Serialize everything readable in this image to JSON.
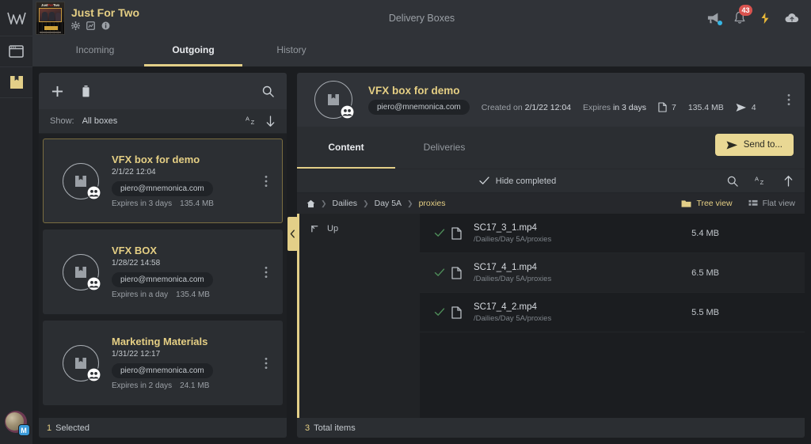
{
  "rail": {
    "logo_icon": "mnemonica-logo-icon",
    "items": [
      {
        "icon": "panel-window-icon",
        "name": "workspace",
        "active": false
      },
      {
        "icon": "delivery-box-icon",
        "name": "delivery-boxes",
        "active": true
      }
    ],
    "avatar_badge": "M"
  },
  "topbar": {
    "poster_title_a": "Just",
    "poster_title_b": "For",
    "poster_title_c": "Two",
    "show_title": "Just For Two",
    "show_icons": [
      "gear-icon",
      "reports-icon",
      "info-icon"
    ],
    "app_title": "Delivery Boxes",
    "right_icons": [
      "megaphone-icon",
      "bell-icon",
      "activity-icon",
      "upload-cloud-icon"
    ],
    "notification_count": "43"
  },
  "tabs": [
    {
      "label": "Incoming",
      "active": false
    },
    {
      "label": "Outgoing",
      "active": true
    },
    {
      "label": "History",
      "active": false
    }
  ],
  "boxes_panel": {
    "toolbar_icons": [
      "add-icon",
      "delete-icon",
      "search-icon"
    ],
    "filter": {
      "show_label": "Show:",
      "show_value": "All boxes",
      "sort_icon": "sort-az-icon",
      "direction_icon": "arrow-down-icon"
    },
    "cards": [
      {
        "name": "VFX box for demo",
        "date": "2/1/22 12:04",
        "email": "piero@mnemonica.com",
        "expires": "Expires in 3 days",
        "size": "135.4 MB",
        "selected": true
      },
      {
        "name": "VFX BOX",
        "date": "1/28/22 14:58",
        "email": "piero@mnemonica.com",
        "expires": "Expires in a day",
        "size": "135.4 MB",
        "selected": false
      },
      {
        "name": "Marketing Materials",
        "date": "1/31/22 12:17",
        "email": "piero@mnemonica.com",
        "expires": "Expires in 2 days",
        "size": "24.1 MB",
        "selected": false
      }
    ],
    "footer_count": "1",
    "footer_label": "Selected"
  },
  "collapse_handle": {
    "icon": "chevron-left-icon"
  },
  "detail": {
    "header": {
      "title": "VFX box for demo",
      "email": "piero@mnemonica.com",
      "created_label": "Created on",
      "created_value": "2/1/22 12:04",
      "expires_label": "Expires",
      "expires_value": "in 3 days",
      "file_count": "7",
      "size": "135.4 MB",
      "deliveries_count": "4",
      "menu_icon": "kebab-menu-icon"
    },
    "tabs": [
      {
        "label": "Content",
        "active": true
      },
      {
        "label": "Deliveries",
        "active": false
      }
    ],
    "send_button": "Send to...",
    "subtools": {
      "hide_completed": "Hide completed",
      "icons": [
        "search-icon",
        "sort-az-icon",
        "arrow-up-icon"
      ]
    },
    "breadcrumb": {
      "home_icon": "home-icon",
      "crumbs": [
        {
          "label": "Dailies",
          "active": false
        },
        {
          "label": "Day 5A",
          "active": false
        },
        {
          "label": "proxies",
          "active": true
        }
      ]
    },
    "views": [
      {
        "label": "Tree view",
        "icon": "folder-icon",
        "active": true
      },
      {
        "label": "Flat view",
        "icon": "list-icon",
        "active": false
      }
    ],
    "tree": [
      {
        "label": "Up",
        "icon": "arrow-up-left-icon"
      }
    ],
    "files": [
      {
        "name": "SC17_3_1.mp4",
        "path": "/Dailies/Day 5A/proxies",
        "size": "5.4 MB",
        "completed": true
      },
      {
        "name": "SC17_4_1.mp4",
        "path": "/Dailies/Day 5A/proxies",
        "size": "6.5 MB",
        "completed": true
      },
      {
        "name": "SC17_4_2.mp4",
        "path": "/Dailies/Day 5A/proxies",
        "size": "5.5 MB",
        "completed": true
      }
    ],
    "footer_count": "3",
    "footer_label": "Total items"
  },
  "colors": {
    "accent": "#e3cf88",
    "badge_red": "#d9534f",
    "check_green": "#4f8f5a",
    "panel": "#2b2e32",
    "chrome": "#303338",
    "background": "#1b1d20"
  }
}
